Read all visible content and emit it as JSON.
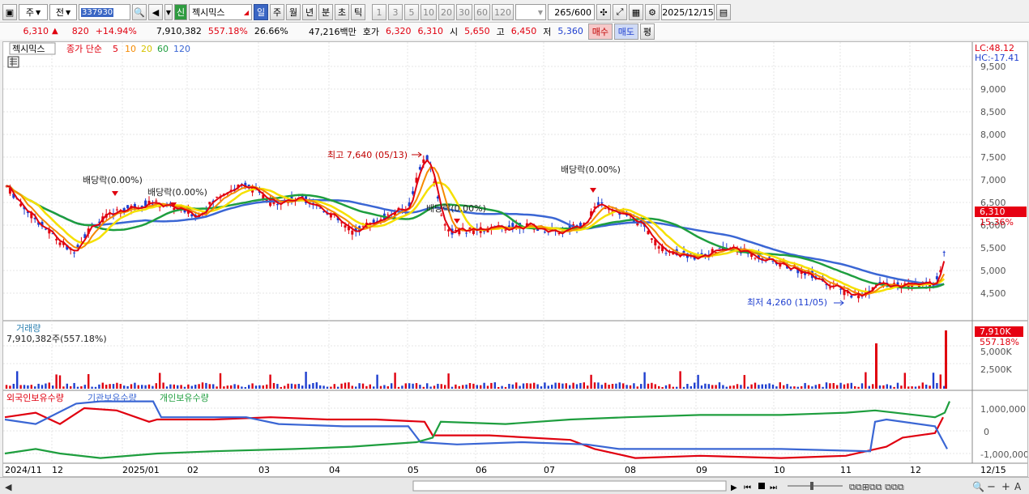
{
  "toolbar": {
    "market": "주",
    "prefix": "전",
    "code": "337930",
    "credit_badge": "신",
    "stock_name": "젝시믹스",
    "periods": [
      "일",
      "주",
      "월",
      "년",
      "분",
      "초",
      "틱"
    ],
    "active_period": "일",
    "intervals": [
      "1",
      "3",
      "5",
      "10",
      "20",
      "30",
      "60",
      "120"
    ],
    "count_value": "265",
    "count_max": "/600",
    "date": "2025/12/15"
  },
  "quote": {
    "price": "6,310",
    "change_arrow": "▲",
    "change": "820",
    "change_pct": "+14.94%",
    "volume": "7,910,382",
    "volume_ratio": "557.18%",
    "turnover": "26.66%",
    "amount": "47,216백만",
    "hoga_label": "호가",
    "ask": "6,320",
    "bid": "6,310",
    "open_label": "시",
    "open": "5,650",
    "high_label": "고",
    "high": "6,450",
    "low_label": "저",
    "low": "5,360",
    "buy_button": "매수",
    "sell_button": "매도",
    "eval_button": "평"
  },
  "legend": {
    "name": "젝시믹스",
    "close_label": "종가 단순",
    "ma5": "5",
    "ma10": "10",
    "ma20": "20",
    "ma60": "60",
    "ma120": "120"
  },
  "corner": {
    "lc": "LC:48.12",
    "hc": "HC:-17.41"
  },
  "annotations": {
    "high": "최고 7,640 (05/13)",
    "low": "최저 4,260 (11/05)",
    "div1": "배당락(0.00%)",
    "div2": "배당락(0.00%)",
    "div3": "배당락(0.00%)",
    "div4": "배당락(0.00%)"
  },
  "price_axis": {
    "ticks": [
      "9,500",
      "9,000",
      "8,500",
      "8,000",
      "7,500",
      "7,000",
      "6,500",
      "6,000",
      "5,500",
      "5,000",
      "4,500"
    ],
    "current_price": "6,310",
    "current_pct": "15.36%"
  },
  "volume_panel": {
    "title": "거래량",
    "value": "7,910,382주(557.18%)",
    "ticks": [
      "5,000K",
      "2,500K"
    ],
    "current": "7,910K",
    "current_pct": "557.18%"
  },
  "holder_panel": {
    "foreign": "외국인보유수량",
    "institution": "기관보유수량",
    "individual": "개인보유수량",
    "ticks": [
      "1,000,000",
      "0",
      "-1,000,000"
    ]
  },
  "x_axis": {
    "labels": [
      "2024/11",
      "12",
      "2025/01",
      "02",
      "03",
      "04",
      "05",
      "06",
      "07",
      "08",
      "09",
      "10",
      "11",
      "12"
    ],
    "right_label": "12/15"
  },
  "colors": {
    "up": "#e0000f",
    "down": "#1f3fcf",
    "ma5": "#e0000f",
    "ma10": "#f58a00",
    "ma20": "#f5e000",
    "ma60": "#1e9e3e",
    "ma120": "#3a66d4"
  }
}
